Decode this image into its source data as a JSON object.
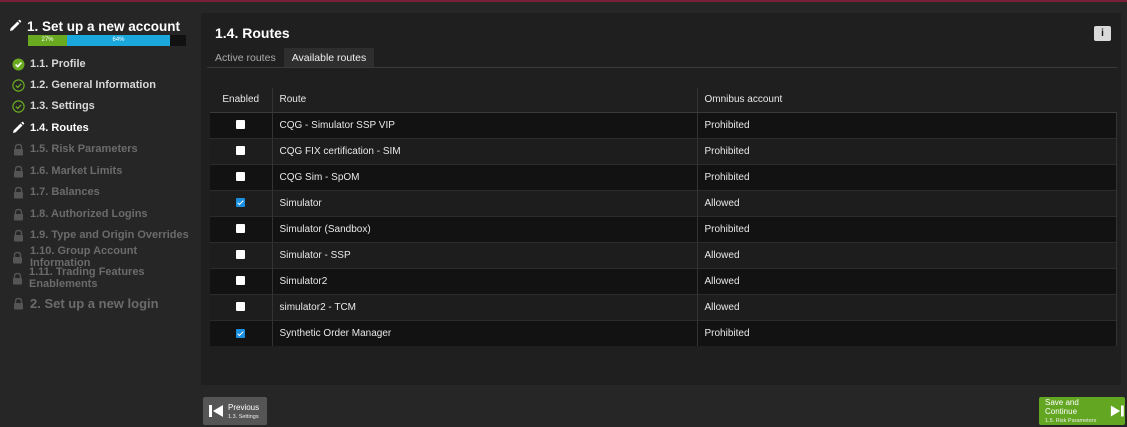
{
  "sidebar": {
    "header": {
      "title": "1. Set up a new account"
    },
    "progress": {
      "segment1_label": "27%",
      "segment2_label": "64%",
      "colors": {
        "complete": "#6aaa21",
        "current": "#1aa7dc"
      }
    },
    "items": [
      {
        "label": "1.1. Profile",
        "state": "done"
      },
      {
        "label": "1.2. General Information",
        "state": "done-outline"
      },
      {
        "label": "1.3. Settings",
        "state": "done-outline"
      },
      {
        "label": "1.4. Routes",
        "state": "active"
      },
      {
        "label": "1.5. Risk Parameters",
        "state": "locked"
      },
      {
        "label": "1.6. Market Limits",
        "state": "locked"
      },
      {
        "label": "1.7. Balances",
        "state": "locked"
      },
      {
        "label": "1.8. Authorized Logins",
        "state": "locked"
      },
      {
        "label": "1.9. Type and Origin Overrides",
        "state": "locked"
      },
      {
        "label": "1.10. Group Account Information",
        "state": "locked"
      },
      {
        "label": "1.11. Trading Features Enablements",
        "state": "locked"
      },
      {
        "label": "2. Set up a new login",
        "state": "locked"
      }
    ]
  },
  "main": {
    "title": "1.4. Routes",
    "info_icon": "i",
    "tabs": [
      {
        "label": "Active routes",
        "active": false
      },
      {
        "label": "Available routes",
        "active": true
      }
    ],
    "table": {
      "columns": [
        "Enabled",
        "Route",
        "Omnibus account"
      ],
      "rows": [
        {
          "enabled": false,
          "route": "CQG - Simulator SSP VIP",
          "omnibus": "Prohibited"
        },
        {
          "enabled": false,
          "route": "CQG FIX certification - SIM",
          "omnibus": "Prohibited"
        },
        {
          "enabled": false,
          "route": "CQG Sim - SpOM",
          "omnibus": "Prohibited"
        },
        {
          "enabled": true,
          "route": "Simulator",
          "omnibus": "Allowed"
        },
        {
          "enabled": false,
          "route": "Simulator (Sandbox)",
          "omnibus": "Prohibited"
        },
        {
          "enabled": false,
          "route": "Simulator - SSP",
          "omnibus": "Allowed"
        },
        {
          "enabled": false,
          "route": "Simulator2",
          "omnibus": "Allowed"
        },
        {
          "enabled": false,
          "route": "simulator2 - TCM",
          "omnibus": "Allowed"
        },
        {
          "enabled": true,
          "route": "Synthetic Order Manager",
          "omnibus": "Prohibited"
        }
      ]
    }
  },
  "footer": {
    "previous": {
      "label": "Previous",
      "sub": "1.3. Settings"
    },
    "next": {
      "label": "Save and Continue",
      "sub": "1.5. Risk Parameters"
    }
  }
}
